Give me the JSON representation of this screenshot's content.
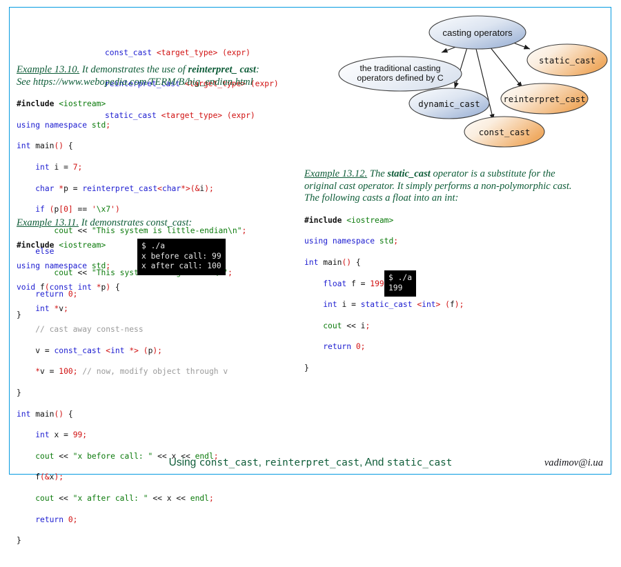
{
  "frame": {
    "border_color": "#049ae0"
  },
  "signatures": {
    "lines": [
      {
        "name": "const_cast",
        "target": "<target_type>",
        "expr": "(expr)"
      },
      {
        "name": "reinterpret_cast",
        "target": "<target_type>",
        "expr": "(expr)"
      },
      {
        "name": "static_cast",
        "target": "<target_type>",
        "expr": "(expr)"
      }
    ]
  },
  "example_1310": {
    "label": "Example 13.10.",
    "text_before": " It demonstrates the use of ",
    "bold_term": "reinterpret_ cast",
    "text_after": ":",
    "url_line": "See https://www.webopedia.com/TERM/B/big_endian.html",
    "code": [
      "#include <iostream>",
      "using namespace std;",
      "int main() {",
      "    int i = 7;",
      "    char *p = reinterpret_cast<char*>(&i);",
      "    if (p[0] == '\\x7')",
      "        cout << \"This system is little-endian\\n\";",
      "    else",
      "        cout << \"This system is big-endian\\n\";",
      "    return 0;",
      "}"
    ]
  },
  "example_1311": {
    "label": "Example 13.11.",
    "text_after": " It demonstrates const_cast:",
    "code": [
      "#include <iostream>",
      "using namespace std;",
      "void f(const int *p) {",
      "    int *v;",
      "    // cast away const-ness",
      "    v = const_cast <int *> (p);",
      "    *v = 100; // now, modify object through v",
      "}",
      "int main() {",
      "    int x = 99;",
      "    cout << \"x before call: \" << x << endl;",
      "    f(&x);",
      "    cout << \"x after call: \" << x << endl;",
      "    return 0;",
      "}"
    ],
    "terminal": [
      "$ ./a",
      "x before call: 99",
      "x after call: 100"
    ]
  },
  "example_1312": {
    "label": "Example 13.12.",
    "text_1": " The ",
    "bold_term": "static_cast",
    "text_2": " operator is a substitute for the original cast operator. It simply performs a non-polymorphic cast. The following casts a float into an int:",
    "code": [
      "#include <iostream>",
      "using namespace std;",
      "int main() {",
      "    float f = 199.22;",
      "    int i = static_cast <int> (f);",
      "    cout << i;",
      "    return 0;",
      "}"
    ],
    "terminal": [
      "$ ./a",
      "199"
    ]
  },
  "diagram": {
    "title": "casting operators",
    "nodes": [
      {
        "id": "root",
        "label": "casting operators",
        "color": "blue"
      },
      {
        "id": "traditional",
        "label": "the traditional casting\noperators defined by C",
        "color": "blue"
      },
      {
        "id": "dynamic",
        "label": "dynamic_cast",
        "color": "blue"
      },
      {
        "id": "const",
        "label": "const_cast",
        "color": "orange"
      },
      {
        "id": "reinterpret",
        "label": "reinterpret_cast",
        "color": "orange"
      },
      {
        "id": "static",
        "label": "static_cast",
        "color": "orange"
      }
    ],
    "edges": [
      {
        "from": "root",
        "to": "traditional"
      },
      {
        "from": "root",
        "to": "dynamic"
      },
      {
        "from": "root",
        "to": "const"
      },
      {
        "from": "root",
        "to": "reinterpret"
      },
      {
        "from": "root",
        "to": "static"
      }
    ],
    "colors": {
      "blue_light": "#f3f6fb",
      "blue_dark": "#9db3d6",
      "orange_light": "#fbf4ed",
      "orange_dark": "#f2b273",
      "stroke": "#4a4a4a"
    }
  },
  "footer": {
    "title_part1": "Using ",
    "title_code1": "const_cast",
    "title_part2": ", ",
    "title_code2": "reinterpret_cast",
    "title_part3": ", And ",
    "title_code3": "static_cast",
    "email": "vadimov@i.ua"
  }
}
